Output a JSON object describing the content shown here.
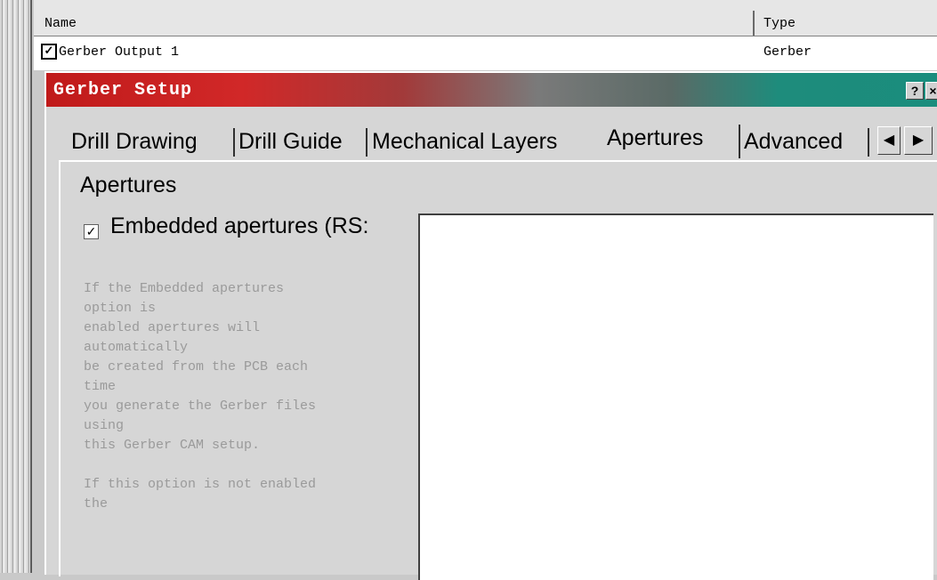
{
  "list": {
    "columns": [
      "Name",
      "Type"
    ],
    "rows": [
      {
        "checked": true,
        "name": "Gerber Output 1",
        "type": "Gerber"
      }
    ]
  },
  "dialog": {
    "title": "Gerber Setup",
    "help_button": "?",
    "close_button": "×",
    "tabs": [
      {
        "label": "Drill Drawing",
        "active": false
      },
      {
        "label": "Drill Guide",
        "active": false
      },
      {
        "label": "Mechanical Layers",
        "active": false
      },
      {
        "label": "Apertures",
        "active": true
      },
      {
        "label": "Advanced",
        "active": false
      }
    ],
    "tab_scroll": {
      "left_icon": "left-arrow-icon",
      "left": "◀",
      "right_icon": "right-arrow-icon",
      "right": "▶"
    },
    "section_title": "Apertures",
    "embedded_apertures": {
      "checked": true,
      "check_glyph": "✓",
      "label": "Embedded apertures (RS:"
    },
    "help_lines": [
      "If the Embedded apertures",
      "option is",
      "enabled apertures will",
      "automatically",
      "be created from the PCB each",
      "time",
      "you generate the Gerber files",
      "using",
      "this Gerber CAM setup.",
      "",
      "If this option is not enabled",
      "the"
    ]
  }
}
